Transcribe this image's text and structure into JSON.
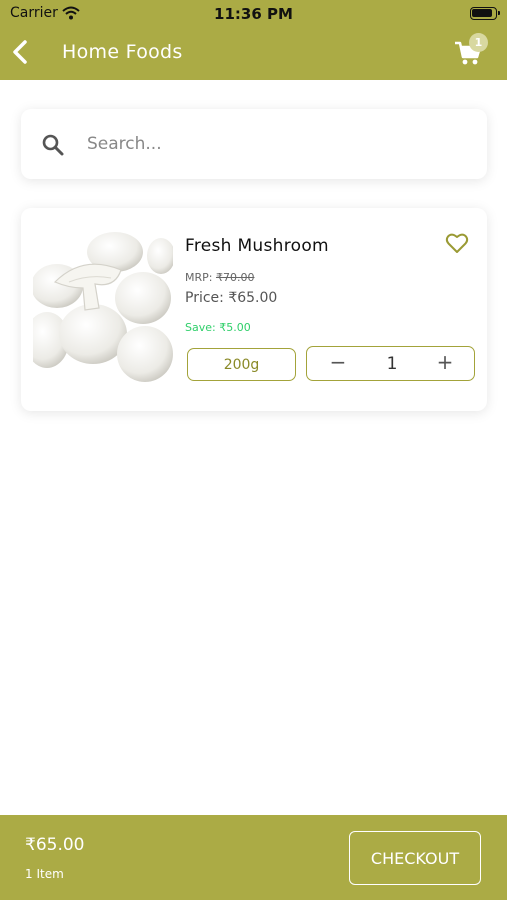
{
  "status_bar": {
    "carrier": "Carrier",
    "time": "11:36 PM"
  },
  "nav": {
    "title": "Home Foods",
    "cart_count": "1"
  },
  "search": {
    "placeholder": "Search..."
  },
  "product": {
    "name": "Fresh Mushroom",
    "mrp_label": "MRP:",
    "mrp_value": "₹70.00",
    "price_label": "Price:",
    "price_value": "₹65.00",
    "save_label": "Save:",
    "save_value": "₹5.00",
    "variant": "200g",
    "minus": "−",
    "quantity": "1",
    "plus": "+"
  },
  "bottom": {
    "total": "₹65.00",
    "items": "1 Item",
    "checkout_label": "CHECKOUT"
  },
  "colors": {
    "brand": "#abab45",
    "accent_border": "#a3a33a",
    "save_green": "#2fcf6a"
  }
}
